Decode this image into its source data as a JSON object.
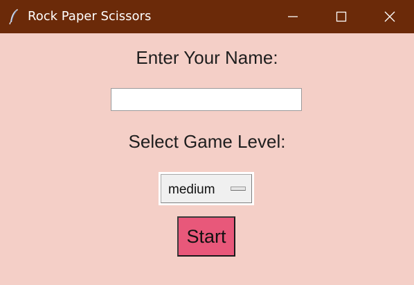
{
  "window": {
    "title": "Rock Paper Scissors",
    "icon": "feather-icon",
    "controls": {
      "minimize": "minimize-icon",
      "maximize": "maximize-icon",
      "close": "close-icon"
    }
  },
  "form": {
    "name_label": "Enter Your Name:",
    "name_value": "",
    "name_placeholder": "",
    "level_label": "Select Game Level:",
    "level_selected": "medium",
    "start_label": "Start"
  },
  "colors": {
    "titlebar": "#6b2a09",
    "background": "#f4cfc7",
    "start_button": "#e8587a"
  }
}
